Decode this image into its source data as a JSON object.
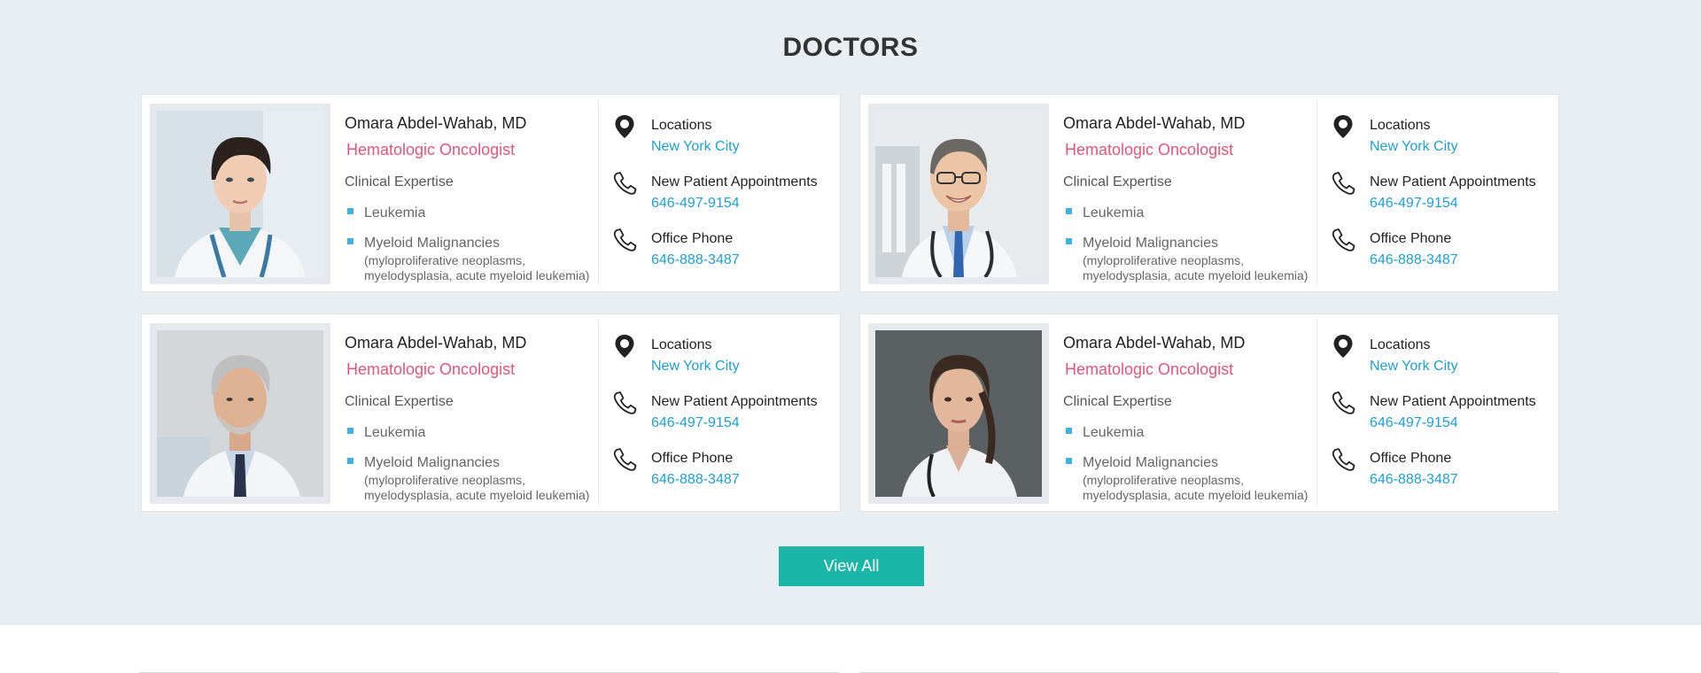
{
  "section": {
    "title": "DOCTORS",
    "view_all_label": "View All"
  },
  "colors": {
    "background": "#e9eef2",
    "specialty": "#e2557a",
    "link": "#1f9fcf",
    "bullet": "#3fb3e0",
    "button": "#1bb6a8"
  },
  "doctors": [
    {
      "photo": "female-doctor-portrait",
      "name": "Omara Abdel-Wahab, MD",
      "specialty": "Hematologic Oncologist",
      "expertise_label": "Clinical Expertise",
      "expertise": [
        {
          "label": "Leukemia",
          "detail": ""
        },
        {
          "label": "Myeloid Malignancies",
          "detail": "(myloproliferative neoplasms, myelodysplasia, acute myeloid leukemia)"
        }
      ],
      "locations_label": "Locations",
      "location": "New York City",
      "appointments_label": "New Patient Appointments",
      "appointments_phone": "646-497-9154",
      "office_label": "Office Phone",
      "office_phone": "646-888-3487"
    },
    {
      "photo": "male-doctor-glasses-portrait",
      "name": "Omara Abdel-Wahab, MD",
      "specialty": "Hematologic Oncologist",
      "expertise_label": "Clinical Expertise",
      "expertise": [
        {
          "label": "Leukemia",
          "detail": ""
        },
        {
          "label": "Myeloid Malignancies",
          "detail": "(myloproliferative neoplasms, myelodysplasia, acute myeloid leukemia)"
        }
      ],
      "locations_label": "Locations",
      "location": "New York City",
      "appointments_label": "New Patient Appointments",
      "appointments_phone": "646-497-9154",
      "office_label": "Office Phone",
      "office_phone": "646-888-3487"
    },
    {
      "photo": "male-doctor-grey-beard-portrait",
      "name": "Omara Abdel-Wahab, MD",
      "specialty": "Hematologic Oncologist",
      "expertise_label": "Clinical Expertise",
      "expertise": [
        {
          "label": "Leukemia",
          "detail": ""
        },
        {
          "label": "Myeloid Malignancies",
          "detail": "(myloproliferative neoplasms, myelodysplasia, acute myeloid leukemia)"
        }
      ],
      "locations_label": "Locations",
      "location": "New York City",
      "appointments_label": "New Patient Appointments",
      "appointments_phone": "646-497-9154",
      "office_label": "Office Phone",
      "office_phone": "646-888-3487"
    },
    {
      "photo": "female-doctor-dark-background-portrait",
      "name": "Omara Abdel-Wahab, MD",
      "specialty": "Hematologic Oncologist",
      "expertise_label": "Clinical Expertise",
      "expertise": [
        {
          "label": "Leukemia",
          "detail": ""
        },
        {
          "label": "Myeloid Malignancies",
          "detail": "(myloproliferative neoplasms, myelodysplasia, acute myeloid leukemia)"
        }
      ],
      "locations_label": "Locations",
      "location": "New York City",
      "appointments_label": "New Patient Appointments",
      "appointments_phone": "646-497-9154",
      "office_label": "Office Phone",
      "office_phone": "646-888-3487"
    }
  ]
}
